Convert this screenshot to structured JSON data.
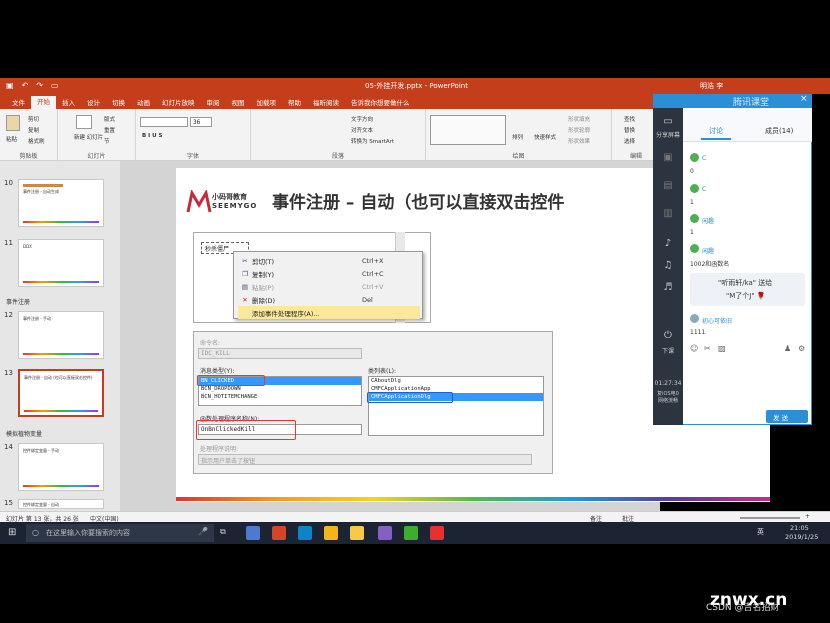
{
  "titlebar": {
    "doc_name": "05-外挂开发.pptx - PowerPoint",
    "user": "明浩 李",
    "qa_icons": [
      "save-icon",
      "undo-icon",
      "redo-icon",
      "present-icon"
    ]
  },
  "ribbon": {
    "tabs": [
      "文件",
      "开始",
      "插入",
      "设计",
      "切换",
      "动画",
      "幻灯片放映",
      "审阅",
      "视图",
      "加载项",
      "帮助",
      "福昕阅读",
      "告诉我你想要做什么"
    ],
    "active_tab": "开始",
    "groups": {
      "clipboard": {
        "label": "剪贴板",
        "paste": "粘贴",
        "cut": "剪切",
        "copy": "复制",
        "format_painter": "格式刷"
      },
      "slides": {
        "label": "幻灯片",
        "new_slide": "新建\n幻灯片",
        "layout": "版式",
        "reset": "重置",
        "section": "节"
      },
      "font": {
        "label": "字体",
        "size": "36"
      },
      "paragraph": {
        "label": "段落",
        "text_direction": "文字方向",
        "align_text": "对齐文本",
        "smartart": "转换为 SmartArt"
      },
      "drawing": {
        "label": "绘图",
        "arrange": "排列",
        "quick_styles": "快速样式",
        "shape_fill": "形状填充",
        "shape_outline": "形状轮廓",
        "shape_effects": "形状效果"
      },
      "editing": {
        "label": "编辑",
        "find": "查找",
        "replace": "替换",
        "select": "选择"
      }
    }
  },
  "slide_panel": {
    "items": [
      {
        "num": "10",
        "title": "事件注册 - 自动生成"
      },
      {
        "num": "11",
        "title": "DDX"
      },
      {
        "section": "事件注册"
      },
      {
        "num": "12",
        "title": "事件注册 - 手动"
      },
      {
        "num": "13",
        "title": "事件注册 - 自动 (也可以直接双击控件)",
        "selected": true
      },
      {
        "section": "模拟植物变量"
      },
      {
        "num": "14",
        "title": "控件绑定变量 - 手动"
      },
      {
        "num": "15",
        "title": "控件绑定变量 - 自动"
      }
    ]
  },
  "slide": {
    "logo_cn": "小码哥教育",
    "logo_en": "SEEMYGO",
    "title": "事件注册 – 自动（也可以直接双击控件",
    "control_label": "秒杀僵尸",
    "context_menu": [
      {
        "icon": "cut-icon",
        "label": "剪切(T)",
        "shortcut": "Ctrl+X"
      },
      {
        "icon": "copy-icon",
        "label": "复制(Y)",
        "shortcut": "Ctrl+C"
      },
      {
        "icon": "paste-icon",
        "label": "粘贴(P)",
        "shortcut": "Ctrl+V",
        "disabled": true
      },
      {
        "icon": "delete-icon",
        "label": "删除(D)",
        "shortcut": "Del"
      },
      {
        "icon": "",
        "label": "添加事件处理程序(A)...",
        "shortcut": "",
        "highlighted": true
      }
    ],
    "wizard": {
      "command_name_label": "命令名:",
      "command_name_value": "IDC_KILL",
      "message_type_label": "消息类型(Y):",
      "message_types": [
        "BN_CLICKED",
        "BCN_DROPDOWN",
        "BCN_HOTITEMCHANGE"
      ],
      "selected_message": "BN_CLICKED",
      "class_list_label": "类列表(L):",
      "classes": [
        "CAboutDlg",
        "CMFCApplicationApp",
        "CMFCApplicationDlg"
      ],
      "selected_class": "CMFCApplicationDlg",
      "handler_label": "函数处理程序名称(N):",
      "handler_value": "OnBnClickedKill",
      "handler_desc_label": "处理程序说明:",
      "handler_desc_value": "指示用户单击了按钮"
    }
  },
  "statusbar": {
    "slide_info": "幻灯片 第 13 张，共 26 张",
    "language": "中文(中国)",
    "notes": "备注",
    "comments": "批注",
    "zoom": "+"
  },
  "taskbar": {
    "search_placeholder": "在这里输入你要搜索的内容",
    "time": "21:05",
    "date": "2019/1/25",
    "ime": "英",
    "icons": [
      {
        "name": "powerpoint-icon",
        "color": "#d24726"
      },
      {
        "name": "visualstudio-code-icon",
        "color": "#0f83c7"
      },
      {
        "name": "app-icon-2",
        "color": "#f3b51a"
      },
      {
        "name": "explorer-icon",
        "color": "#f7c948"
      },
      {
        "name": "visualstudio-icon",
        "color": "#865fc5"
      },
      {
        "name": "camtasia-icon-1",
        "color": "#3dae2b"
      },
      {
        "name": "camtasia-icon-2",
        "color": "#3dae2b"
      },
      {
        "name": "app-icon-red",
        "color": "#e8312c"
      }
    ]
  },
  "chat": {
    "tabs": {
      "discuss": "讨论",
      "members": "成员(14)"
    },
    "side_items": [
      "分享屏幕",
      "下课"
    ],
    "timer": "01:27:34",
    "side_bottom": "复iOS电0\n网络流畅",
    "messages": [
      {
        "text": "C",
        "time": "0"
      },
      {
        "text": "C",
        "time": "1"
      },
      {
        "text": "闲趣",
        "time": "1"
      },
      {
        "text": "闲趣",
        "time": "1002和函数名"
      }
    ],
    "gift": {
      "line1": "\"听雨轩/ka\"  送给",
      "line2": "\"M了个J\" 🌹"
    },
    "last_user": "初心可依旧",
    "last_msg": "1111",
    "send_label": "发 送",
    "brand": "腾讯课堂",
    "colors": {
      "accent": "#2b8fd8",
      "sidebar": "#2c3440"
    }
  },
  "watermark": {
    "site": "znwx.cn",
    "credit": "CSDN @吉名招财"
  }
}
